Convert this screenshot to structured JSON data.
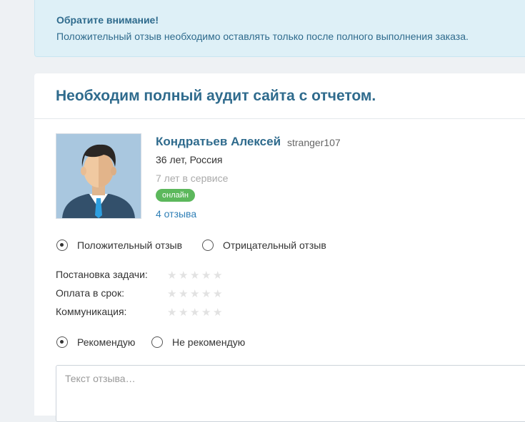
{
  "notice": {
    "title": "Обратите внимание!",
    "text": "Положительный отзыв необходимо оставлять только после полного выполнения заказа."
  },
  "order": {
    "title": "Необходим полный аудит сайта с отчетом."
  },
  "user": {
    "avatar_icon": "user-avatar-icon",
    "name": "Кондратьев Алексей",
    "login": "stranger107",
    "age_country": "36 лет, Россия",
    "service_time": "7 лет в сервисе",
    "status": "онлайн",
    "reviews": "4 отзыва"
  },
  "review_type": {
    "options": [
      "Положительный отзыв",
      "Отрицательный отзыв"
    ],
    "selected": "Положительный отзыв"
  },
  "criteria": [
    {
      "label": "Постановка задачи:",
      "rating": 0,
      "max": 5
    },
    {
      "label": "Оплата в срок:",
      "rating": 0,
      "max": 5
    },
    {
      "label": "Коммуникация:",
      "rating": 0,
      "max": 5
    }
  ],
  "recommend": {
    "options": [
      "Рекомендую",
      "Не рекомендую"
    ],
    "selected": "Рекомендую"
  },
  "review_text": {
    "placeholder": "Текст отзыва…",
    "value": ""
  },
  "colors": {
    "accent": "#2f6b8d",
    "link": "#2f7fb6",
    "online": "#5cb85c",
    "notice_bg": "#def0f7"
  }
}
